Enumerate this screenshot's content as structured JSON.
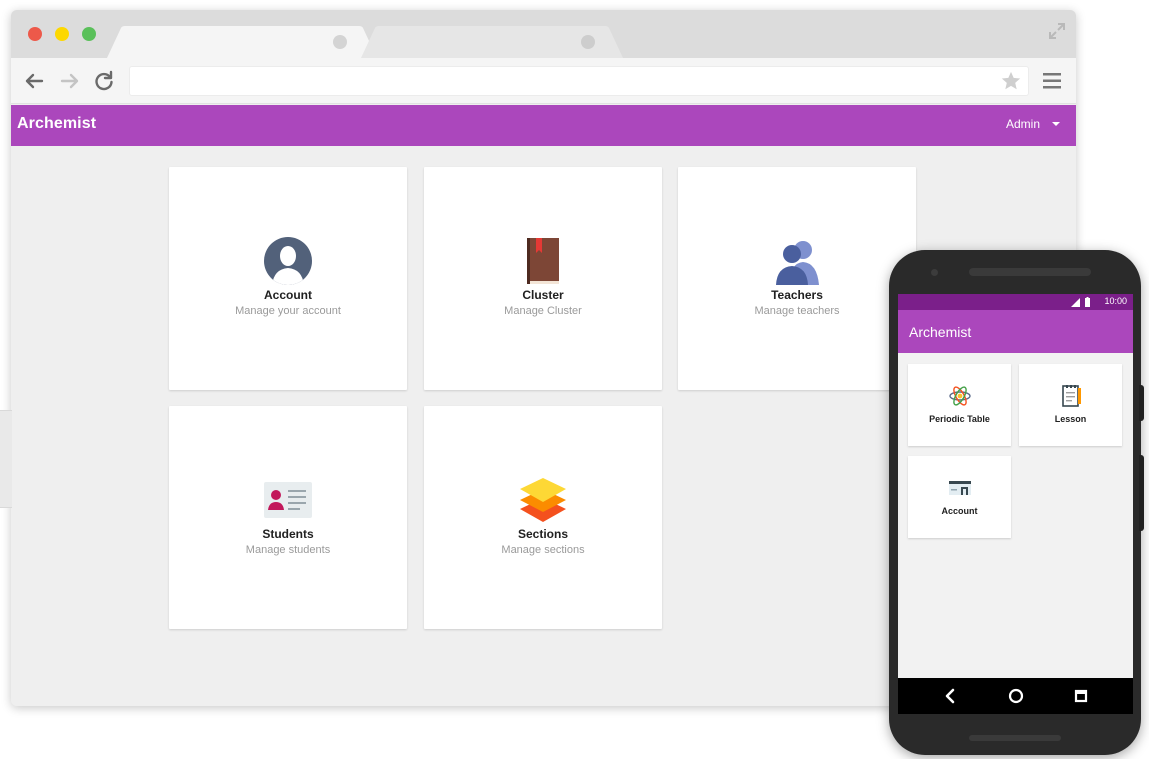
{
  "browser": {
    "address": {
      "value": "",
      "placeholder": ""
    }
  },
  "app": {
    "title": "Archemist",
    "user_menu": {
      "label": "Admin"
    }
  },
  "cards": [
    {
      "title": "Account",
      "subtitle": "Manage your account",
      "icon": "account-avatar-icon"
    },
    {
      "title": "Cluster",
      "subtitle": "Manage Cluster",
      "icon": "book-icon"
    },
    {
      "title": "Teachers",
      "subtitle": "Manage teachers",
      "icon": "people-icon"
    },
    {
      "title": "Students",
      "subtitle": "Manage students",
      "icon": "id-card-icon"
    },
    {
      "title": "Sections",
      "subtitle": "Manage sections",
      "icon": "layers-icon"
    }
  ],
  "phone": {
    "status_time": "10:00",
    "app_title": "Archemist",
    "tiles": [
      {
        "label": "Periodic Table",
        "icon": "atom-icon"
      },
      {
        "label": "Lesson",
        "icon": "notebook-icon"
      },
      {
        "label": "Account",
        "icon": "card-reader-icon"
      }
    ]
  },
  "colors": {
    "accent": "#ab47bc",
    "status_bar": "#7b1f8a",
    "background": "#efefef"
  }
}
